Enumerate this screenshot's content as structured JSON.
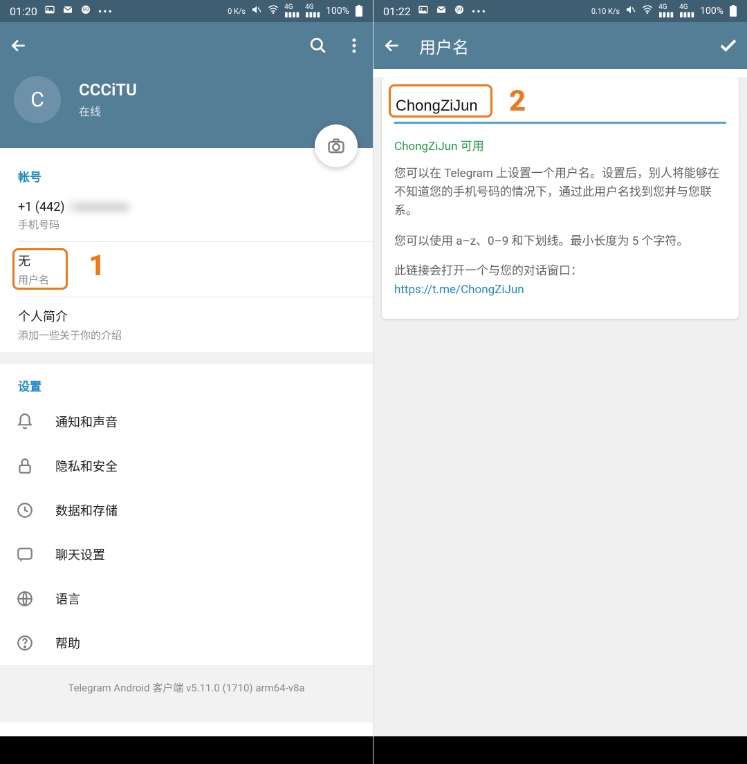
{
  "left": {
    "status": {
      "time": "01:20",
      "net": "0 K/s",
      "battery": "100%"
    },
    "profile": {
      "initial": "C",
      "name": "CCCiTU",
      "status": "在线"
    },
    "account": {
      "section_title": "帐号",
      "phone_prefix": "+1 (442)",
      "phone_masked": "2■■■■■■",
      "phone_label": "手机号码",
      "username_value": "无",
      "username_label": "用户名",
      "bio_value": "个人简介",
      "bio_label": "添加一些关于你的介绍"
    },
    "settings": {
      "section_title": "设置",
      "items": [
        {
          "label": "通知和声音",
          "icon": "bell-icon"
        },
        {
          "label": "隐私和安全",
          "icon": "lock-icon"
        },
        {
          "label": "数据和存储",
          "icon": "clock-icon"
        },
        {
          "label": "聊天设置",
          "icon": "chat-icon"
        },
        {
          "label": "语言",
          "icon": "globe-icon"
        },
        {
          "label": "帮助",
          "icon": "help-icon"
        }
      ]
    },
    "footer": "Telegram Android 客户端 v5.11.0 (1710) arm64-v8a",
    "annotation_number": "1"
  },
  "right": {
    "status": {
      "time": "01:22",
      "net": "0.10 K/s",
      "battery": "100%"
    },
    "toolbar_title": "用户名",
    "username_value": "ChongZiJun",
    "status_text": "ChongZiJun 可用",
    "help_p1": "您可以在 Telegram 上设置一个用户名。设置后，别人将能够在不知道您的手机号码的情况下，通过此用户名找到您并与您联系。",
    "help_p2": "您可以使用 a–z、0–9 和下划线。最小长度为 5 个字符。",
    "help_p3": "此链接会打开一个与您的对话窗口：",
    "link_text": "https://t.me/ChongZiJun",
    "annotation_number": "2"
  }
}
